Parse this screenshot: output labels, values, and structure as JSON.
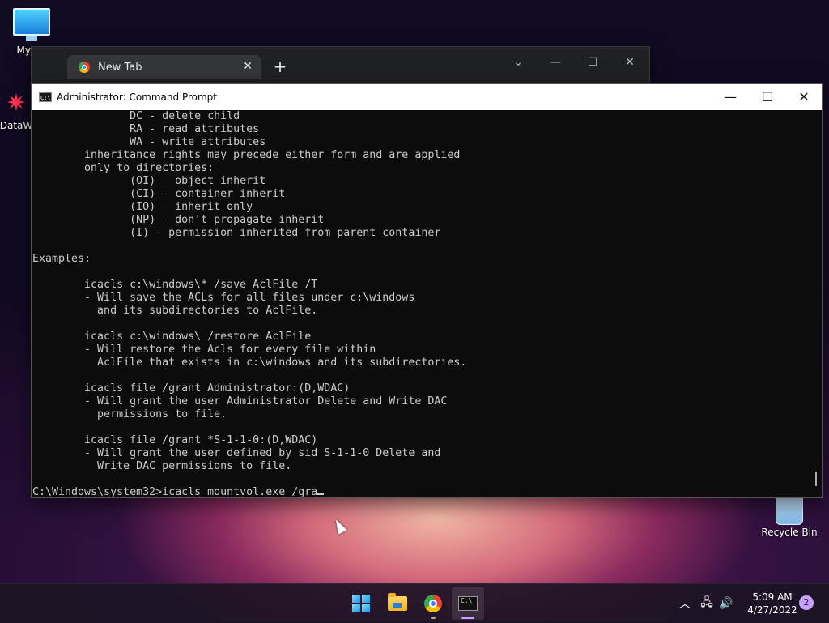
{
  "desktop": {
    "icons": [
      {
        "label": "My Co",
        "icon": "monitor-icon"
      },
      {
        "label": "DataW",
        "icon": "datawarehouse-icon"
      },
      {
        "label": "Recycle Bin",
        "icon": "recycle-bin-icon"
      }
    ]
  },
  "browser": {
    "tab_title": "New Tab",
    "close_glyph": "✕",
    "new_tab_glyph": "+",
    "controls": [
      "⌄",
      "—",
      "☐",
      "✕"
    ]
  },
  "cmd": {
    "title": "Administrator: Command Prompt",
    "controls": [
      "—",
      "☐",
      "✕"
    ],
    "lines": [
      "               DC - delete child",
      "               RA - read attributes",
      "               WA - write attributes",
      "        inheritance rights may precede either form and are applied",
      "        only to directories:",
      "               (OI) - object inherit",
      "               (CI) - container inherit",
      "               (IO) - inherit only",
      "               (NP) - don't propagate inherit",
      "               (I) - permission inherited from parent container",
      "",
      "Examples:",
      "",
      "        icacls c:\\windows\\* /save AclFile /T",
      "        - Will save the ACLs for all files under c:\\windows",
      "          and its subdirectories to AclFile.",
      "",
      "        icacls c:\\windows\\ /restore AclFile",
      "        - Will restore the Acls for every file within",
      "          AclFile that exists in c:\\windows and its subdirectories.",
      "",
      "        icacls file /grant Administrator:(D,WDAC)",
      "        - Will grant the user Administrator Delete and Write DAC",
      "          permissions to file.",
      "",
      "        icacls file /grant *S-1-1-0:(D,WDAC)",
      "        - Will grant the user defined by sid S-1-1-0 Delete and",
      "          Write DAC permissions to file.",
      ""
    ],
    "prompt": "C:\\Windows\\system32>icacls mountvol.exe /gra"
  },
  "taskbar": {
    "apps": [
      "start-icon",
      "file-explorer-icon",
      "chrome-icon",
      "terminal-icon"
    ],
    "tray_icons": [
      "chevron-up-icon",
      "network-icon",
      "volume-icon"
    ],
    "time": "5:09 AM",
    "date": "4/27/2022",
    "notification_count": "2"
  }
}
